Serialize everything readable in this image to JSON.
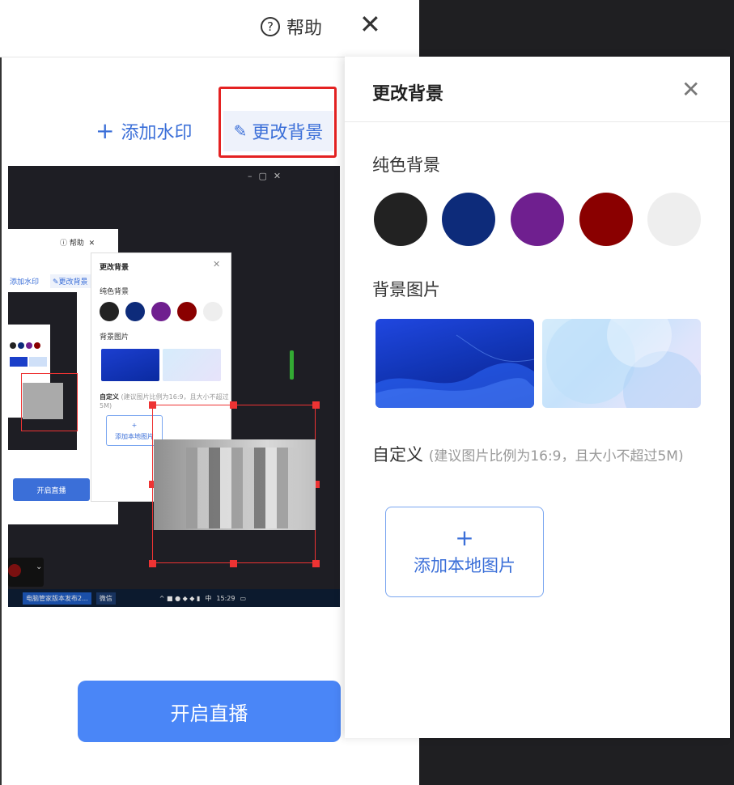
{
  "topbar": {
    "help_label": "帮助",
    "help_icon": "help-circle-icon",
    "close_icon": "close-icon"
  },
  "toolbar": {
    "add_watermark_label": "添加水印",
    "change_background_label": "更改背景"
  },
  "preview": {
    "inner_help_label": "帮助",
    "inner_add_watermark": "添加水印",
    "inner_change_background": "更改背景",
    "inner_panel_title": "更改背景",
    "inner_solid": "纯色背景",
    "inner_bg_image": "背景图片",
    "inner_custom": "自定义",
    "inner_custom_hint": "(建议图片比例为16:9，且大小不超过5M)",
    "inner_add_local": "添加本地图片",
    "inner_start": "开启直播",
    "taskbar_time": "15:29",
    "taskbar_ime": "中",
    "taskbar_app1": "电脑管家版本发布2...",
    "taskbar_app2": "微信"
  },
  "start_button_label": "开启直播",
  "panel": {
    "title": "更改背景",
    "solid_section": "纯色背景",
    "swatches": [
      "#222222",
      "#0d2b7a",
      "#6f1f8f",
      "#8a0000",
      "#eeeeee"
    ],
    "image_section": "背景图片",
    "custom_label": "自定义",
    "custom_hint": "(建议图片比例为16:9，且大小不超过5M)",
    "upload_plus": "+",
    "upload_label": "添加本地图片"
  },
  "colors": {
    "accent": "#4a86f7",
    "highlight": "#e42222"
  }
}
